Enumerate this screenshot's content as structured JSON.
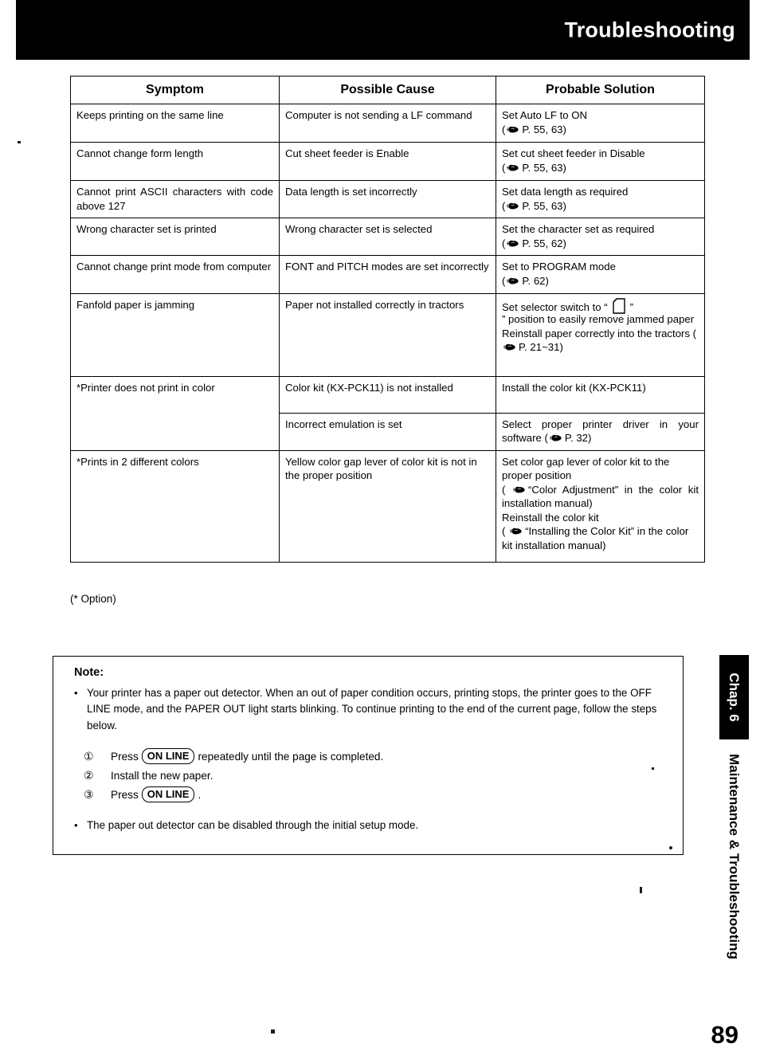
{
  "header": {
    "title": "Troubleshooting"
  },
  "table": {
    "headers": [
      "Symptom",
      "Possible Cause",
      "Probable Solution"
    ],
    "rows": [
      {
        "symptom": "Keeps printing on the same line",
        "cause": "Computer is not sending a LF command",
        "solution_lines": [
          "Set Auto LF to ON",
          "( ☞  P. 55, 63)"
        ],
        "solution_ref": "P. 55, 63"
      },
      {
        "symptom": "Cannot change form length",
        "cause": "Cut sheet feeder is Enable",
        "solution_lines": [
          "Set cut sheet feeder in Disable",
          "( ☞  P. 55, 63)"
        ],
        "solution_ref": "P. 55, 63"
      },
      {
        "symptom": "Cannot print ASCII characters with code above 127",
        "cause": "Data length is set incorrectly",
        "solution_lines": [
          "Set data length as required",
          "( ☞  P. 55, 63)"
        ],
        "solution_ref": "P. 55, 63"
      },
      {
        "symptom": "Wrong character set is printed",
        "cause": "Wrong character set is selected",
        "solution_lines": [
          "Set the character set as required",
          "( ☞  P. 55, 62)"
        ],
        "solution_ref": "P. 55, 62"
      },
      {
        "symptom": "Cannot change print mode from computer",
        "cause": "FONT and PITCH modes are set incorrectly",
        "solution_lines": [
          "Set to PROGRAM mode",
          "( ☞  P. 62)"
        ],
        "solution_ref": "P. 62"
      },
      {
        "symptom": "Fanfold paper is jamming",
        "cause": "Paper not installed correctly in tractors",
        "solution_part1": "Set selector switch to “",
        "solution_part2": "” position to easily remove jammed paper",
        "solution_part3": "Reinstall paper correctly into the tractors (",
        "solution_ref": "P. 21~31",
        "solution_part4": ")"
      },
      {
        "symptom": "*Printer does not print in color",
        "cause": "Color kit (KX-PCK11) is not installed",
        "solution": "Install the color kit (KX-PCK11)"
      },
      {
        "symptom": "",
        "cause": "Incorrect emulation is set",
        "solution_part1": "Select proper printer driver in your software (",
        "solution_ref": "P. 32",
        "solution_part2": ")"
      },
      {
        "symptom": "*Prints in 2 different colors",
        "cause": "Yellow color gap lever of color kit is not in the proper position",
        "solution_line1": "Set color gap lever of color kit to the proper position",
        "solution_line2_pre": "( ",
        "solution_line2": "“Color Adjustment” in the color kit installation manual)",
        "solution_line3": "Reinstall the color kit",
        "solution_line4_pre": "( ",
        "solution_line4": "“Installing the Color Kit” in the color kit installation manual)"
      }
    ]
  },
  "option_note": "(* Option)",
  "note": {
    "title": "Note:",
    "bullet_char": "•",
    "paragraph1": "Your printer has a paper out detector. When an out of paper condition occurs, printing stops, the printer goes to the OFF LINE mode, and the PAPER OUT light starts blinking. To continue printing to the end of the current page, follow the steps below.",
    "steps": [
      {
        "num": "①",
        "pre": "Press",
        "key": "ON LINE",
        "post": "repeatedly until the page is completed."
      },
      {
        "num": "②",
        "pre": "Install the new paper.",
        "key": "",
        "post": ""
      },
      {
        "num": "③",
        "pre": "Press",
        "key": "ON LINE",
        "post": "."
      }
    ],
    "paragraph2": "The paper out detector can be disabled through the initial setup mode."
  },
  "sidebar": {
    "chapter_tab": "Chap. 6",
    "chapter_name": "Maintenance & Troubleshooting"
  },
  "page_number": "89",
  "icons": {
    "hand": "pointing-hand-icon",
    "sheet": "cut-sheet-icon"
  }
}
